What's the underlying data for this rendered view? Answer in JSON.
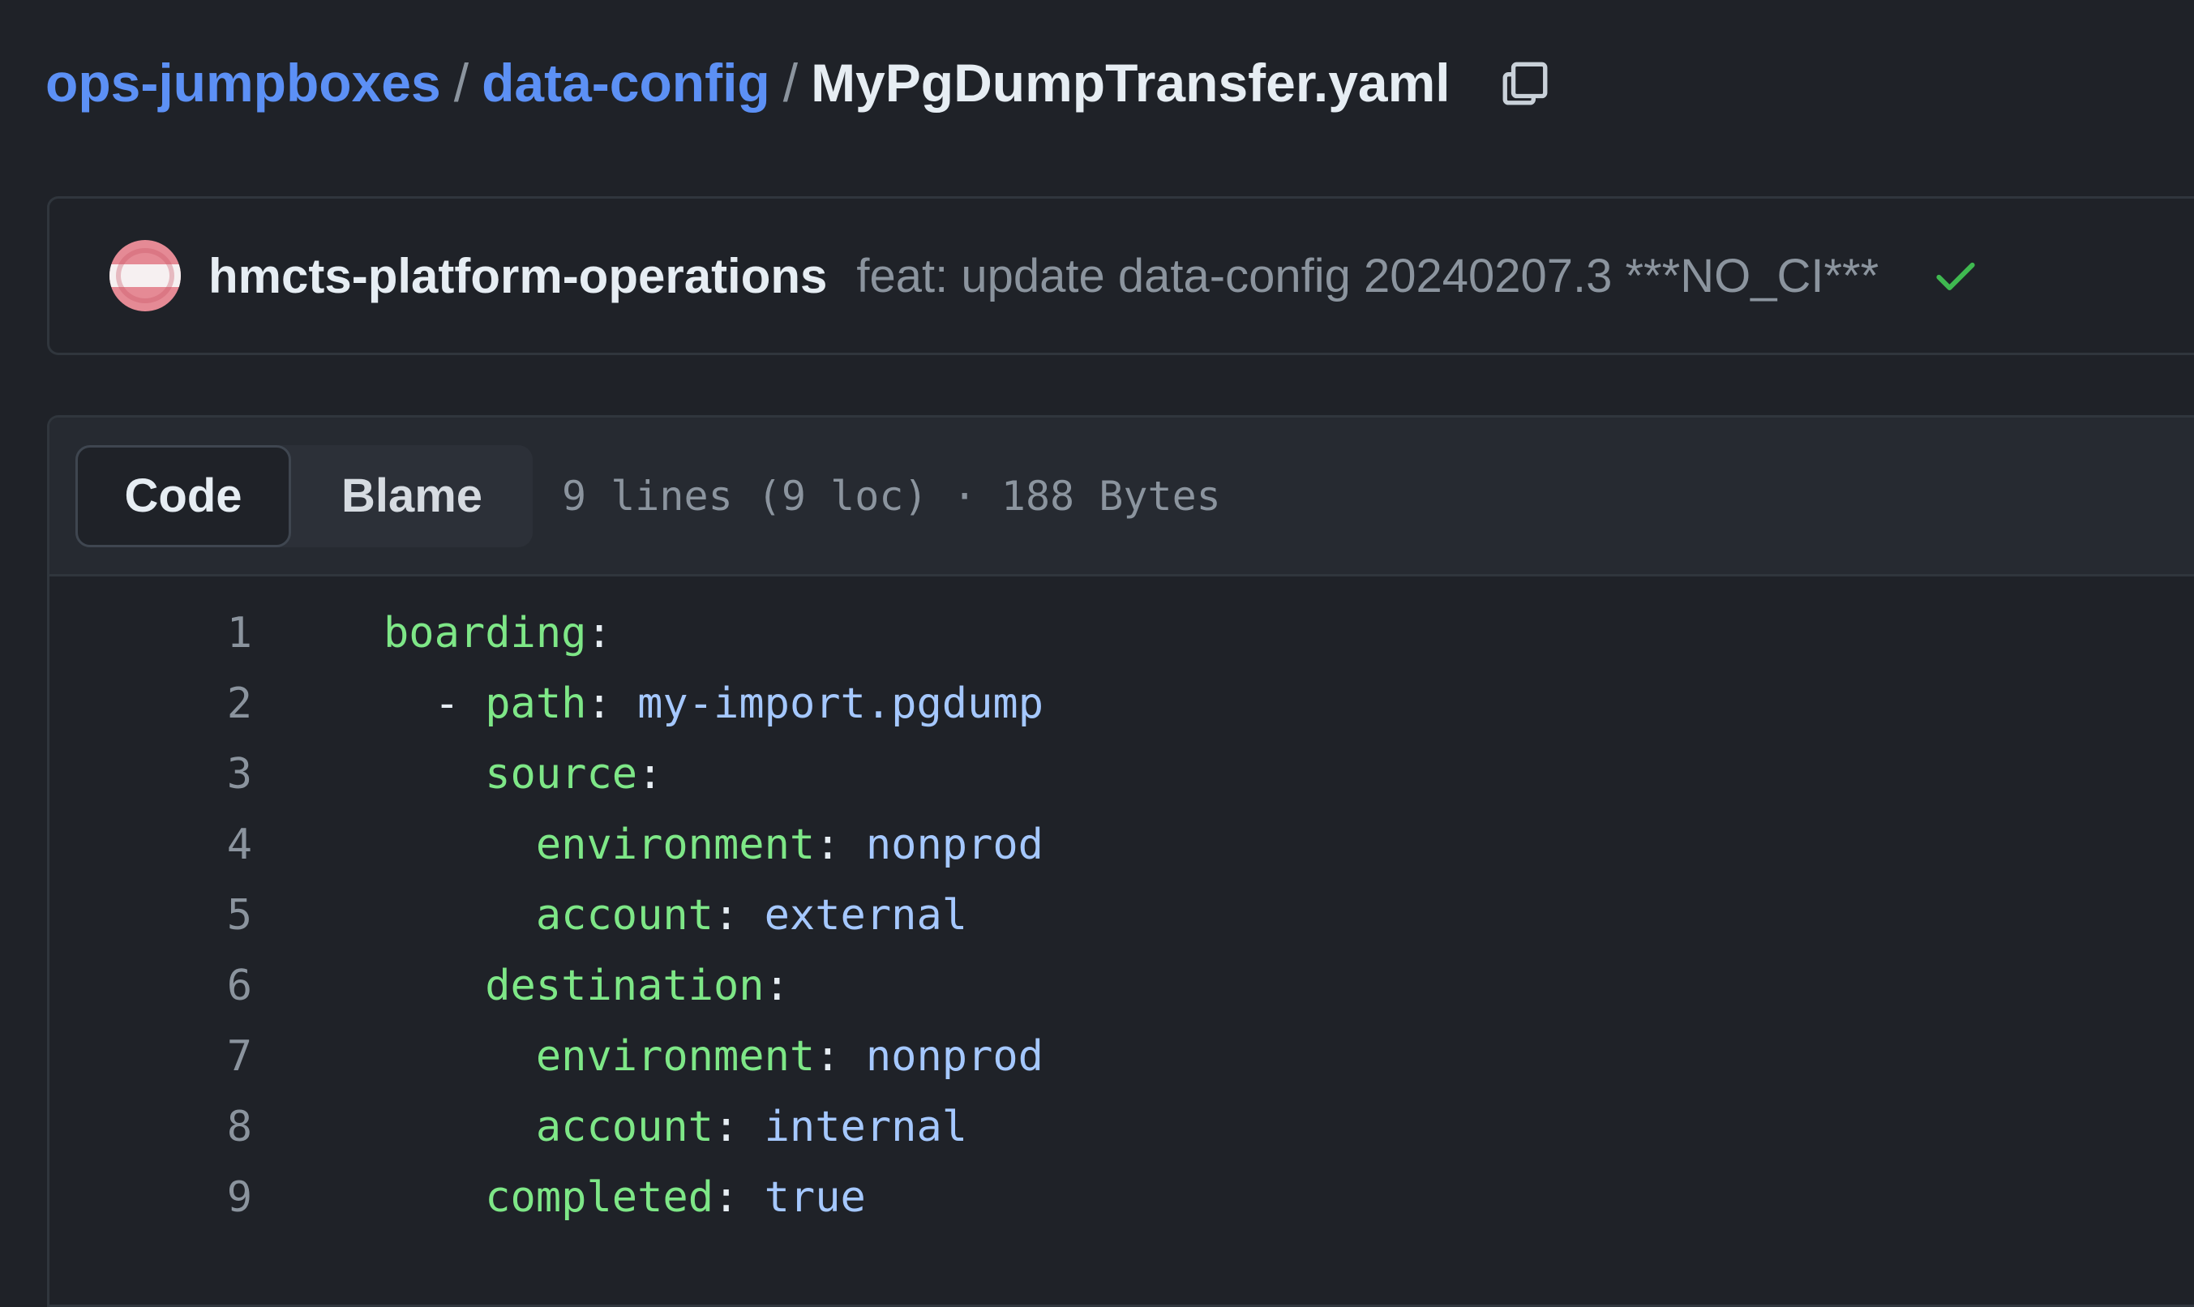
{
  "breadcrumb": {
    "repo": "ops-jumpboxes",
    "folder": "data-config",
    "separator": "/",
    "file": "MyPgDumpTransfer.yaml"
  },
  "commit": {
    "author": "hmcts-platform-operations",
    "message": "feat: update data-config 20240207.3 ***NO_CI***",
    "status": "success",
    "status_color": "#3fb950"
  },
  "file_header": {
    "tabs": [
      {
        "label": "Code",
        "active": true
      },
      {
        "label": "Blame",
        "active": false
      }
    ],
    "meta": "9 lines (9 loc) · 188 Bytes"
  },
  "code": {
    "lines": [
      {
        "num": "1",
        "indent": "",
        "dash": "",
        "key": "boarding",
        "colon": ":",
        "value": ""
      },
      {
        "num": "2",
        "indent": "  ",
        "dash": "- ",
        "key": "path",
        "colon": ":",
        "value": " my-import.pgdump"
      },
      {
        "num": "3",
        "indent": "    ",
        "dash": "",
        "key": "source",
        "colon": ":",
        "value": ""
      },
      {
        "num": "4",
        "indent": "      ",
        "dash": "",
        "key": "environment",
        "colon": ":",
        "value": " nonprod"
      },
      {
        "num": "5",
        "indent": "      ",
        "dash": "",
        "key": "account",
        "colon": ":",
        "value": " external"
      },
      {
        "num": "6",
        "indent": "    ",
        "dash": "",
        "key": "destination",
        "colon": ":",
        "value": ""
      },
      {
        "num": "7",
        "indent": "      ",
        "dash": "",
        "key": "environment",
        "colon": ":",
        "value": " nonprod"
      },
      {
        "num": "8",
        "indent": "      ",
        "dash": "",
        "key": "account",
        "colon": ":",
        "value": " internal"
      },
      {
        "num": "9",
        "indent": "    ",
        "dash": "",
        "key": "completed",
        "colon": ":",
        "value": " true"
      }
    ]
  },
  "colors": {
    "link": "#5c90f5",
    "yaml_key": "#7ee787",
    "yaml_value": "#a5c8ff",
    "background": "#1f2228"
  },
  "icons": {
    "copy": "copy-icon",
    "check": "check-icon",
    "avatar": "avatar"
  }
}
